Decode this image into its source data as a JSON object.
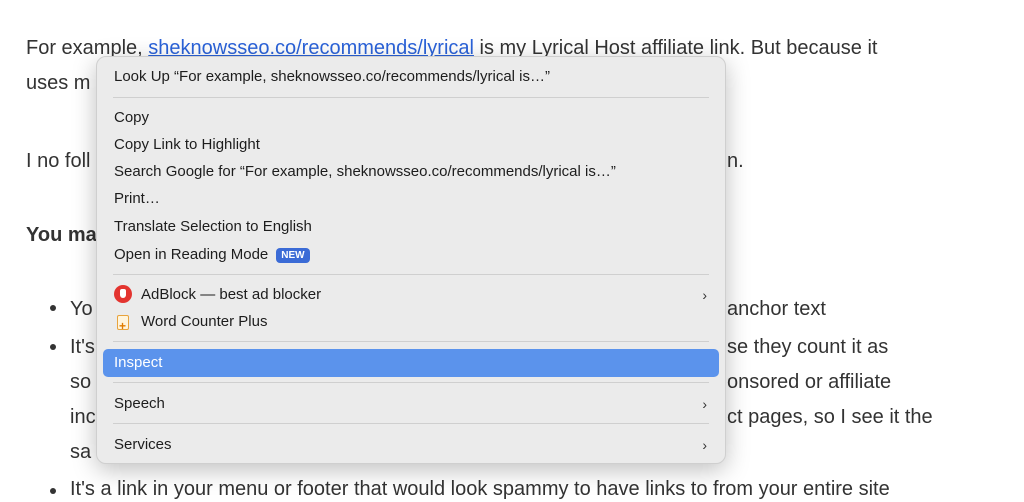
{
  "article": {
    "p1_before": "For example, ",
    "p1_link": "sheknowsseo.co/recommends/lyrical",
    "p1_after": " is my Lyrical Host affiliate link. But because it",
    "p1_l2": "uses m",
    "p2_left": "I no foll",
    "p2_right": "n.",
    "heading_left": "You ma",
    "b1_left": "Yo",
    "b1_right": "anchor text",
    "b2_left": "It's",
    "b2_right": "se they count it as",
    "b2_l2_left": "so",
    "b2_l2_right": "onsored or affiliate",
    "b2_l3_left": "inc",
    "b2_l3_right": "ct pages, so I see it the",
    "b2_l4_left": "sa",
    "b3": "It's a link in your menu or footer that would look spammy to have links to from your entire site"
  },
  "menu": {
    "lookup": "Look Up “For example, sheknowsseo.co/recommends/lyrical is…”",
    "copy": "Copy",
    "copy_link": "Copy Link to Highlight",
    "search_google": "Search Google for “For example, sheknowsseo.co/recommends/lyrical is…”",
    "print": "Print…",
    "translate": "Translate Selection to English",
    "reading_mode": "Open in Reading Mode",
    "new_badge": "NEW",
    "adblock": "AdBlock — best ad blocker",
    "word_counter": "Word Counter Plus",
    "inspect": "Inspect",
    "speech": "Speech",
    "services": "Services",
    "chevron": "›"
  },
  "colors": {
    "link": "#2a62d9",
    "selection": "#5b93ec",
    "badge": "#3b6bd6",
    "adblock": "#e3342f"
  },
  "icons": [
    "adblock-icon",
    "word-counter-icon",
    "chevron-right-icon"
  ]
}
